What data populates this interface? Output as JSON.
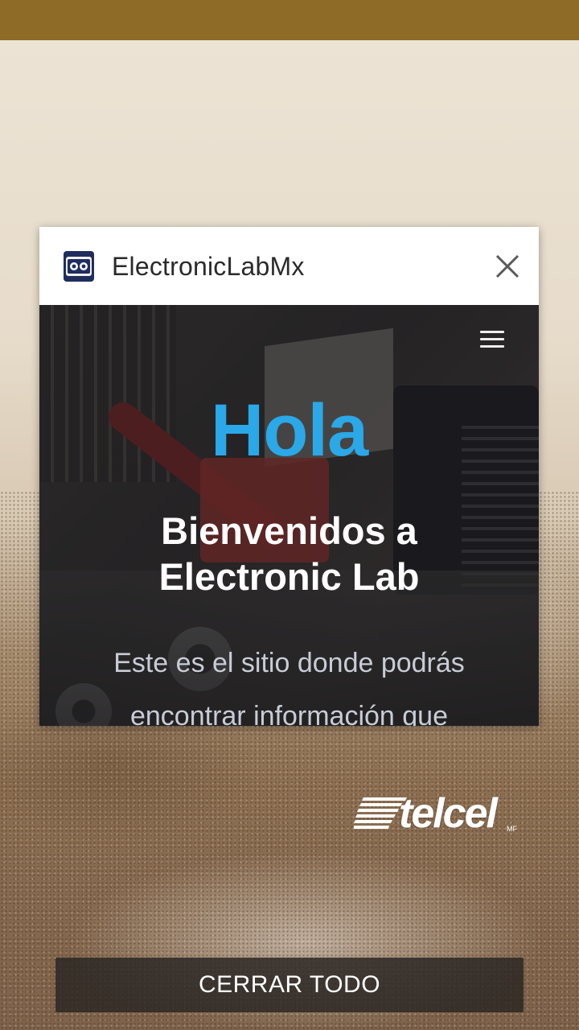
{
  "task": {
    "app_title": "ElectronicLabMx",
    "app_icon": "electroniclab-logo-icon",
    "close_icon": "close-icon"
  },
  "website": {
    "menu_icon": "hamburger-menu-icon",
    "headline": "Hola",
    "welcome_line1": "Bienvenidos a",
    "welcome_line2": "Electronic Lab",
    "description_line1": "Este es el sitio donde podrás",
    "description_line2": "encontrar información que",
    "headline_color": "#2aa8e8"
  },
  "carrier": {
    "name": "telcel",
    "suffix": "MF"
  },
  "footer": {
    "close_all_label": "CERRAR TODO"
  },
  "colors": {
    "status_bar": "#8e6b27",
    "card_header": "#ffffff"
  }
}
